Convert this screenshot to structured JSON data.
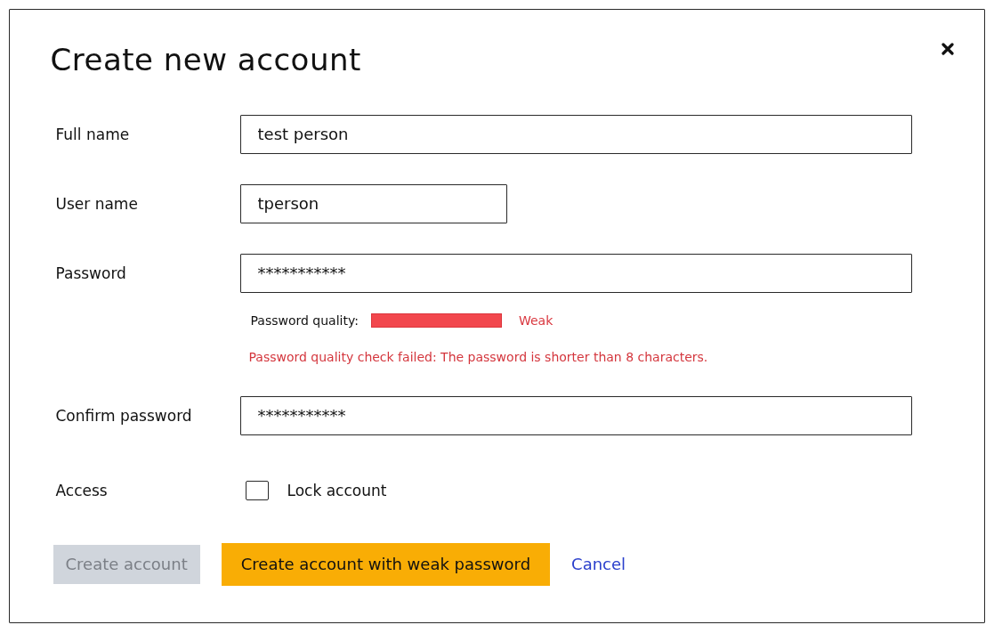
{
  "dialog": {
    "title": "Create new account"
  },
  "fields": [
    {
      "kind": "text",
      "label": "Full name",
      "value": "test person"
    },
    {
      "kind": "short_text",
      "label": "User name",
      "value": "tperson"
    },
    {
      "kind": "password",
      "label": "Password",
      "value": "***********",
      "quality": {
        "label": "Password quality:",
        "level": 1,
        "reading": "Weak"
      },
      "error": "Password quality check failed: The password is shorter than 8 characters."
    },
    {
      "kind": "password",
      "label": "Confirm password",
      "value": "***********"
    },
    {
      "kind": "checkbox",
      "label": "Access",
      "option": "Lock account",
      "checked": false
    }
  ],
  "buttons": [
    {
      "kind": "primary",
      "label": "Create account",
      "disabled": true
    },
    {
      "kind": "warning",
      "label": "Create account with weak password",
      "disabled": false
    },
    {
      "kind": "link",
      "label": "Cancel",
      "disabled": false
    }
  ]
}
